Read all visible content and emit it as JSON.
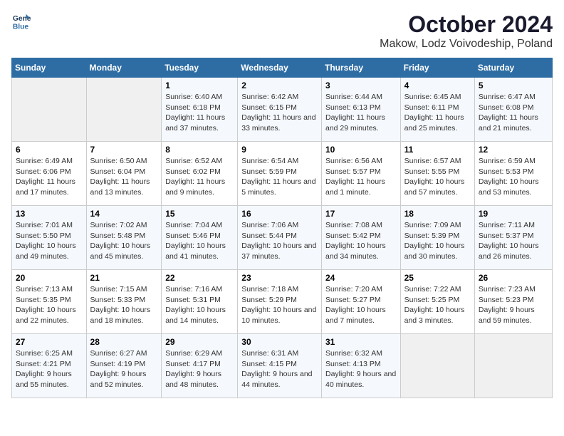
{
  "logo": {
    "line1": "General",
    "line2": "Blue"
  },
  "title": "October 2024",
  "subtitle": "Makow, Lodz Voivodeship, Poland",
  "days_of_week": [
    "Sunday",
    "Monday",
    "Tuesday",
    "Wednesday",
    "Thursday",
    "Friday",
    "Saturday"
  ],
  "weeks": [
    [
      {
        "day": "",
        "info": ""
      },
      {
        "day": "",
        "info": ""
      },
      {
        "day": "1",
        "info": "Sunrise: 6:40 AM\nSunset: 6:18 PM\nDaylight: 11 hours and 37 minutes."
      },
      {
        "day": "2",
        "info": "Sunrise: 6:42 AM\nSunset: 6:15 PM\nDaylight: 11 hours and 33 minutes."
      },
      {
        "day": "3",
        "info": "Sunrise: 6:44 AM\nSunset: 6:13 PM\nDaylight: 11 hours and 29 minutes."
      },
      {
        "day": "4",
        "info": "Sunrise: 6:45 AM\nSunset: 6:11 PM\nDaylight: 11 hours and 25 minutes."
      },
      {
        "day": "5",
        "info": "Sunrise: 6:47 AM\nSunset: 6:08 PM\nDaylight: 11 hours and 21 minutes."
      }
    ],
    [
      {
        "day": "6",
        "info": "Sunrise: 6:49 AM\nSunset: 6:06 PM\nDaylight: 11 hours and 17 minutes."
      },
      {
        "day": "7",
        "info": "Sunrise: 6:50 AM\nSunset: 6:04 PM\nDaylight: 11 hours and 13 minutes."
      },
      {
        "day": "8",
        "info": "Sunrise: 6:52 AM\nSunset: 6:02 PM\nDaylight: 11 hours and 9 minutes."
      },
      {
        "day": "9",
        "info": "Sunrise: 6:54 AM\nSunset: 5:59 PM\nDaylight: 11 hours and 5 minutes."
      },
      {
        "day": "10",
        "info": "Sunrise: 6:56 AM\nSunset: 5:57 PM\nDaylight: 11 hours and 1 minute."
      },
      {
        "day": "11",
        "info": "Sunrise: 6:57 AM\nSunset: 5:55 PM\nDaylight: 10 hours and 57 minutes."
      },
      {
        "day": "12",
        "info": "Sunrise: 6:59 AM\nSunset: 5:53 PM\nDaylight: 10 hours and 53 minutes."
      }
    ],
    [
      {
        "day": "13",
        "info": "Sunrise: 7:01 AM\nSunset: 5:50 PM\nDaylight: 10 hours and 49 minutes."
      },
      {
        "day": "14",
        "info": "Sunrise: 7:02 AM\nSunset: 5:48 PM\nDaylight: 10 hours and 45 minutes."
      },
      {
        "day": "15",
        "info": "Sunrise: 7:04 AM\nSunset: 5:46 PM\nDaylight: 10 hours and 41 minutes."
      },
      {
        "day": "16",
        "info": "Sunrise: 7:06 AM\nSunset: 5:44 PM\nDaylight: 10 hours and 37 minutes."
      },
      {
        "day": "17",
        "info": "Sunrise: 7:08 AM\nSunset: 5:42 PM\nDaylight: 10 hours and 34 minutes."
      },
      {
        "day": "18",
        "info": "Sunrise: 7:09 AM\nSunset: 5:39 PM\nDaylight: 10 hours and 30 minutes."
      },
      {
        "day": "19",
        "info": "Sunrise: 7:11 AM\nSunset: 5:37 PM\nDaylight: 10 hours and 26 minutes."
      }
    ],
    [
      {
        "day": "20",
        "info": "Sunrise: 7:13 AM\nSunset: 5:35 PM\nDaylight: 10 hours and 22 minutes."
      },
      {
        "day": "21",
        "info": "Sunrise: 7:15 AM\nSunset: 5:33 PM\nDaylight: 10 hours and 18 minutes."
      },
      {
        "day": "22",
        "info": "Sunrise: 7:16 AM\nSunset: 5:31 PM\nDaylight: 10 hours and 14 minutes."
      },
      {
        "day": "23",
        "info": "Sunrise: 7:18 AM\nSunset: 5:29 PM\nDaylight: 10 hours and 10 minutes."
      },
      {
        "day": "24",
        "info": "Sunrise: 7:20 AM\nSunset: 5:27 PM\nDaylight: 10 hours and 7 minutes."
      },
      {
        "day": "25",
        "info": "Sunrise: 7:22 AM\nSunset: 5:25 PM\nDaylight: 10 hours and 3 minutes."
      },
      {
        "day": "26",
        "info": "Sunrise: 7:23 AM\nSunset: 5:23 PM\nDaylight: 9 hours and 59 minutes."
      }
    ],
    [
      {
        "day": "27",
        "info": "Sunrise: 6:25 AM\nSunset: 4:21 PM\nDaylight: 9 hours and 55 minutes."
      },
      {
        "day": "28",
        "info": "Sunrise: 6:27 AM\nSunset: 4:19 PM\nDaylight: 9 hours and 52 minutes."
      },
      {
        "day": "29",
        "info": "Sunrise: 6:29 AM\nSunset: 4:17 PM\nDaylight: 9 hours and 48 minutes."
      },
      {
        "day": "30",
        "info": "Sunrise: 6:31 AM\nSunset: 4:15 PM\nDaylight: 9 hours and 44 minutes."
      },
      {
        "day": "31",
        "info": "Sunrise: 6:32 AM\nSunset: 4:13 PM\nDaylight: 9 hours and 40 minutes."
      },
      {
        "day": "",
        "info": ""
      },
      {
        "day": "",
        "info": ""
      }
    ]
  ]
}
